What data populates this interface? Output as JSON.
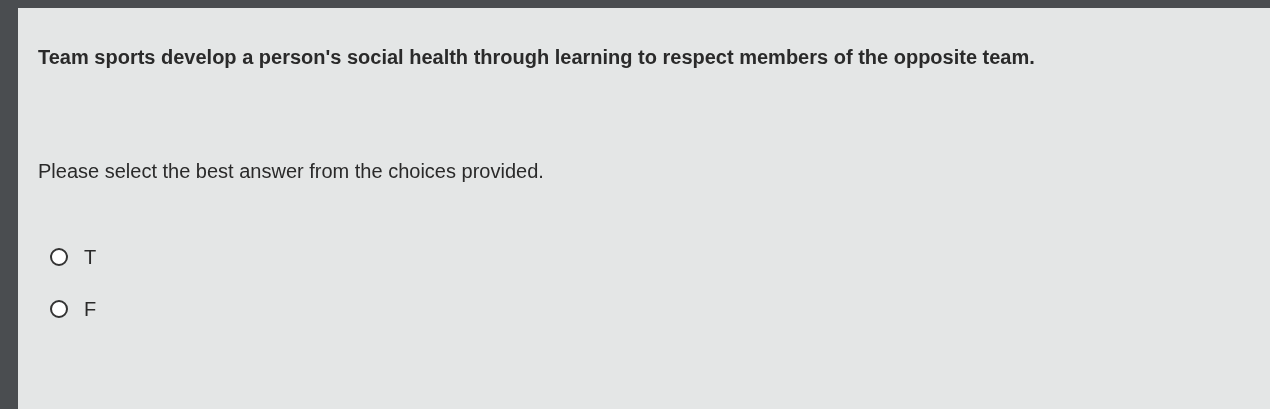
{
  "question": "Team sports develop a person's social health through learning to respect members of the opposite team.",
  "instruction": "Please select the best answer from the choices provided.",
  "choices": [
    {
      "label": "T",
      "selected": false
    },
    {
      "label": "F",
      "selected": false
    }
  ]
}
